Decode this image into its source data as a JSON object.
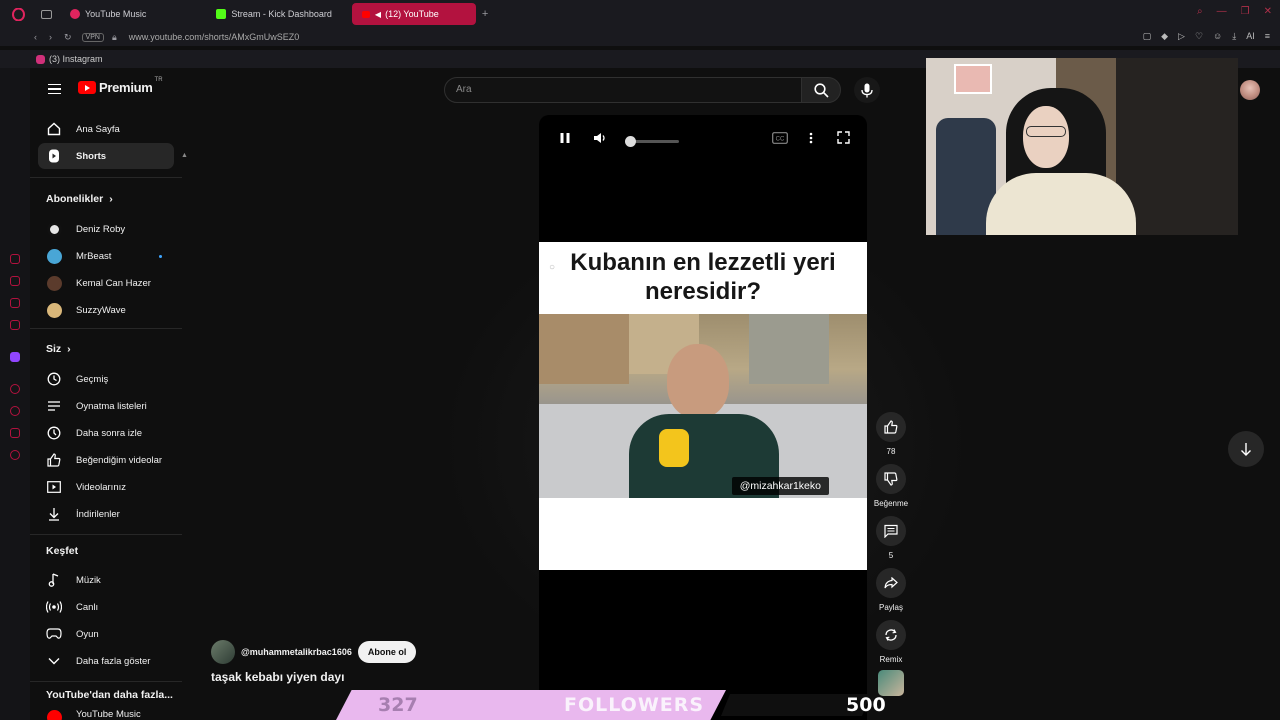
{
  "browser": {
    "tabs": [
      {
        "label": "YouTube Music",
        "active": false,
        "fav_color": "#e0245e"
      },
      {
        "label": "Stream - Kick Dashboard",
        "active": false,
        "fav_color": "#53fc18"
      },
      {
        "label": "(12) YouTube",
        "active": true,
        "fav_color": "#ff0000"
      }
    ],
    "vpn_label": "VPN",
    "url": "www.youtube.com/shorts/AMxGmUwSEZ0",
    "bookmark": "(3) Instagram"
  },
  "youtube": {
    "logo_text": "Premium",
    "logo_region": "TR",
    "search_placeholder": "Ara",
    "sidebar": {
      "main": [
        {
          "label": "Ana Sayfa",
          "icon": "home-icon",
          "active": false
        },
        {
          "label": "Shorts",
          "icon": "shorts-icon",
          "active": true
        }
      ],
      "subscriptions_title": "Abonelikler",
      "subscriptions": [
        {
          "label": "Deniz Roby",
          "color": "#e6e6e6"
        },
        {
          "label": "MrBeast",
          "color": "#49a6d6",
          "new": true
        },
        {
          "label": "Kemal Can Hazer",
          "color": "#5b3b2c"
        },
        {
          "label": "SuzzyWave",
          "color": "#d9b77a"
        }
      ],
      "you_title": "Siz",
      "you": [
        {
          "label": "Geçmiş",
          "icon": "history-icon"
        },
        {
          "label": "Oynatma listeleri",
          "icon": "playlist-icon"
        },
        {
          "label": "Daha sonra izle",
          "icon": "watch-later-icon"
        },
        {
          "label": "Beğendiğim videolar",
          "icon": "like-icon"
        },
        {
          "label": "Videolarınız",
          "icon": "your-videos-icon"
        },
        {
          "label": "İndirilenler",
          "icon": "download-icon"
        }
      ],
      "explore_title": "Keşfet",
      "explore": [
        {
          "label": "Müzik",
          "icon": "music-icon"
        },
        {
          "label": "Canlı",
          "icon": "live-icon"
        },
        {
          "label": "Oyun",
          "icon": "gaming-icon"
        },
        {
          "label": "Daha fazla göster",
          "icon": "chevron-down-icon"
        }
      ],
      "more_title": "YouTube'dan daha fazla...",
      "more_first": "YouTube Music"
    },
    "short": {
      "overlay_title": "Kubanın en lezzetli yeri neresidir?",
      "watermark": "@mizahkar1keko",
      "channel": "@muhammetalikrbac1606",
      "subscribe_label": "Abone ol",
      "title": "taşak kebabı yiyen dayı",
      "volume": 0.2
    },
    "actions": [
      {
        "name": "like",
        "label": "78",
        "icon": "thumbs-up-icon"
      },
      {
        "name": "dislike",
        "label": "Beğenme",
        "icon": "thumbs-down-icon"
      },
      {
        "name": "comments",
        "label": "5",
        "icon": "comment-icon"
      },
      {
        "name": "share",
        "label": "Paylaş",
        "icon": "share-icon"
      },
      {
        "name": "remix",
        "label": "Remix",
        "icon": "remix-icon"
      }
    ]
  },
  "stream_overlay": {
    "current": "327",
    "label": "FOLLOWERS",
    "goal": "500"
  }
}
